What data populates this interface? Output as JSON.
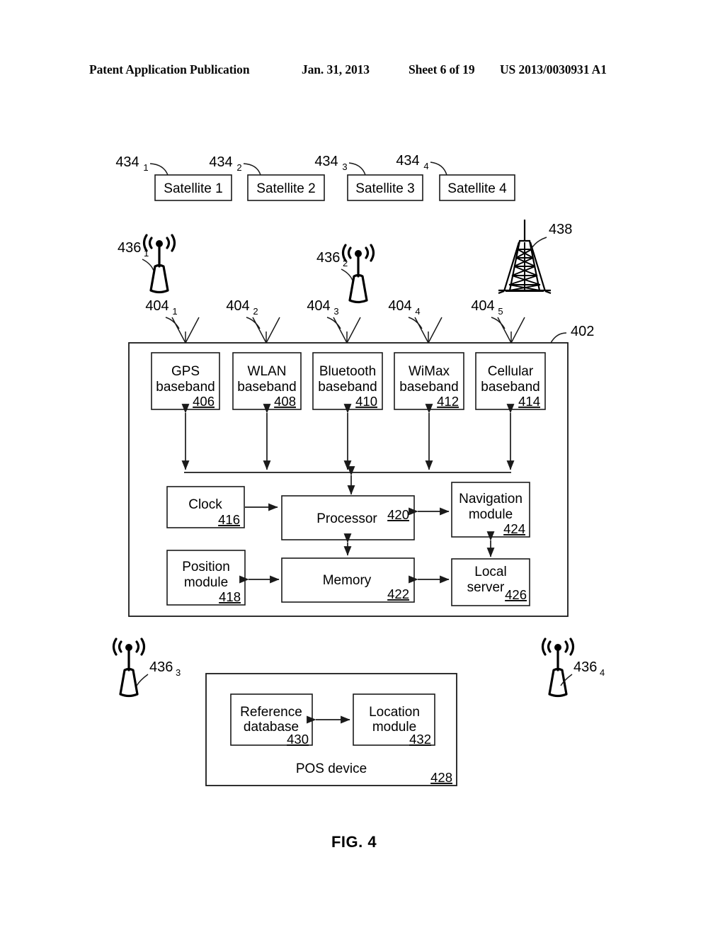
{
  "header": {
    "publication": "Patent Application Publication",
    "date": "Jan. 31, 2013",
    "sheet": "Sheet 6 of 19",
    "number": "US 2013/0030931 A1"
  },
  "figure": {
    "caption": "FIG. 4"
  },
  "satellites": [
    {
      "label": "Satellite 1",
      "ref": "434",
      "sub": "1"
    },
    {
      "label": "Satellite 2",
      "ref": "434",
      "sub": "2"
    },
    {
      "label": "Satellite 3",
      "ref": "434",
      "sub": "3"
    },
    {
      "label": "Satellite 4",
      "ref": "434",
      "sub": "4"
    }
  ],
  "access_points": [
    {
      "ref": "436",
      "sub": "1"
    },
    {
      "ref": "436",
      "sub": "2"
    },
    {
      "ref": "436",
      "sub": "3"
    },
    {
      "ref": "436",
      "sub": "4"
    }
  ],
  "tower": {
    "ref": "438"
  },
  "antennas": [
    {
      "ref": "404",
      "sub": "1"
    },
    {
      "ref": "404",
      "sub": "2"
    },
    {
      "ref": "404",
      "sub": "3"
    },
    {
      "ref": "404",
      "sub": "4"
    },
    {
      "ref": "404",
      "sub": "5"
    }
  ],
  "device": {
    "ref": "402",
    "basebands": [
      {
        "line1": "GPS",
        "line2": "baseband",
        "ref": "406"
      },
      {
        "line1": "WLAN",
        "line2": "baseband",
        "ref": "408"
      },
      {
        "line1": "Bluetooth",
        "line2": "baseband",
        "ref": "410"
      },
      {
        "line1": "WiMax",
        "line2": "baseband",
        "ref": "412"
      },
      {
        "line1": "Cellular",
        "line2": "baseband",
        "ref": "414"
      }
    ],
    "clock": {
      "line1": "Clock",
      "line2": "",
      "ref": "416"
    },
    "position": {
      "line1": "Position",
      "line2": "module",
      "ref": "418"
    },
    "processor": {
      "line1": "Processor",
      "line2": "",
      "ref": "420"
    },
    "memory": {
      "line1": "Memory",
      "line2": "",
      "ref": "422"
    },
    "navigation": {
      "line1": "Navigation",
      "line2": "module",
      "ref": "424"
    },
    "localserver": {
      "line1": "Local",
      "line2": "server",
      "ref": "426"
    }
  },
  "pos_device": {
    "label": "POS device",
    "ref": "428",
    "reference_database": {
      "line1": "Reference",
      "line2": "database",
      "ref": "430"
    },
    "location_module": {
      "line1": "Location",
      "line2": "module",
      "ref": "432"
    }
  },
  "colors": {
    "ink": "#1a1a1a",
    "paper": "#ffffff"
  }
}
